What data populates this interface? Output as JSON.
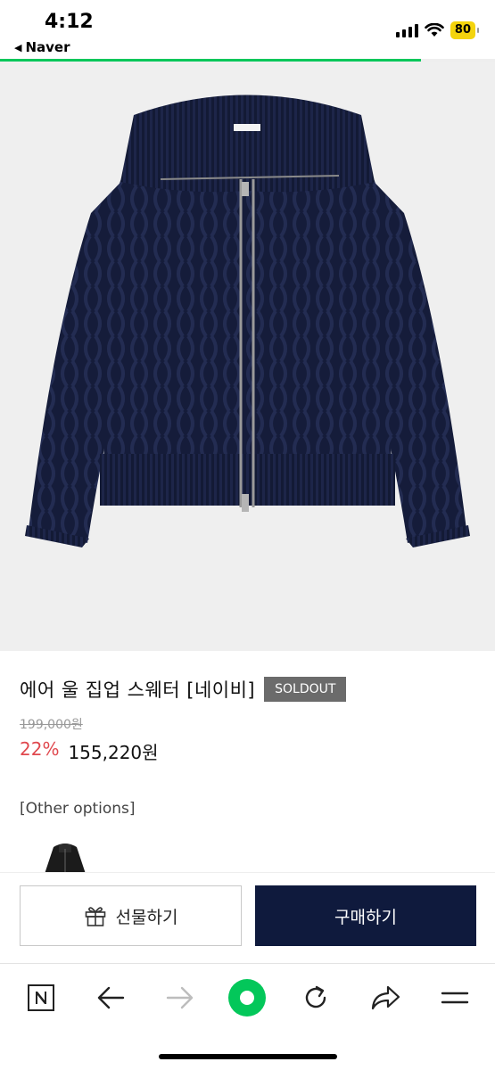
{
  "status_bar": {
    "time": "4:12",
    "back_app": "Naver",
    "battery": "80"
  },
  "page_progress": 0.85,
  "product": {
    "title": "에어 울 집업 스웨터 [네이비]",
    "badge": "SOLDOUT",
    "original_price": "199,000원",
    "discount": "22%",
    "price": "155,220원",
    "image_icon": "navy-cable-knit-zip-sweater-image"
  },
  "options": {
    "label": "[Other options]",
    "thumbnail_icon": "black-sweater-thumbnail"
  },
  "actions": {
    "gift_label": "선물하기",
    "buy_label": "구매하기"
  },
  "browser_toolbar": {
    "items": [
      "naver-n-icon",
      "back-arrow-icon",
      "forward-arrow-icon",
      "green-dot-icon",
      "refresh-icon",
      "share-icon",
      "menu-icon"
    ]
  },
  "colors": {
    "progress": "#03c75a",
    "discount": "#e0484e",
    "buy_button": "#0f1a3d",
    "soldout_badge": "#6b6b6b",
    "battery": "#f4d40d"
  }
}
